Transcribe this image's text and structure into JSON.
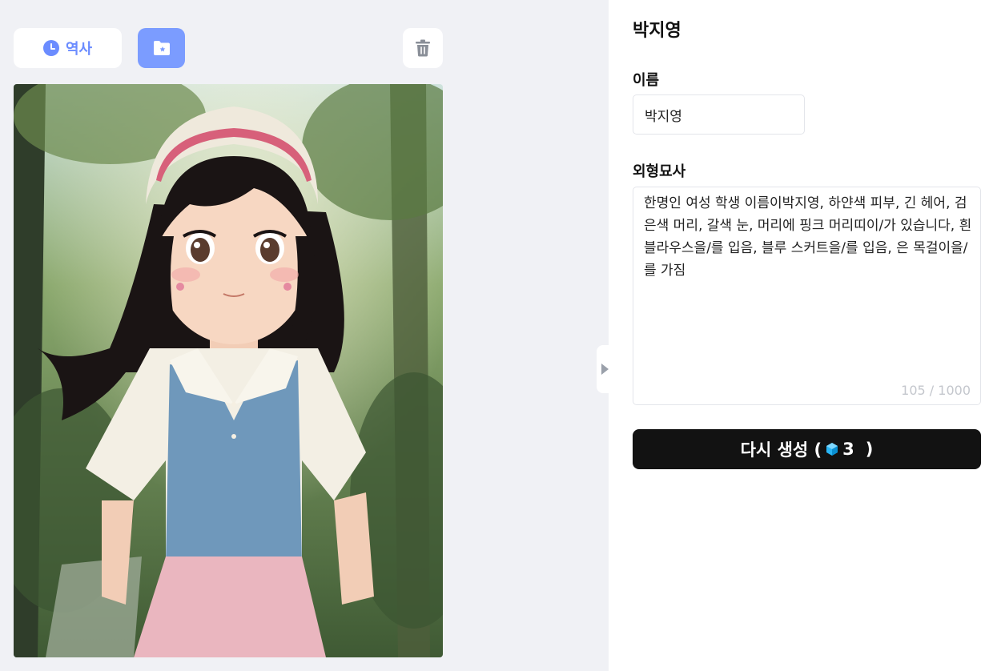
{
  "toolbar": {
    "history_label": "역사",
    "history_icon": "clock-icon",
    "folder_icon": "folder-star-icon",
    "trash_icon": "trash-icon"
  },
  "image": {
    "subject": "character-portrait",
    "colors": {
      "sky": "#cfe3dd",
      "forest": "#5e7a48",
      "hat": "#efe9dc",
      "hat_band": "#d7607a",
      "hair": "#1a1414",
      "skin": "#f7d7c2",
      "blouse": "#f3efe4",
      "vest": "#6f98bb",
      "skirt": "#eab6bf"
    }
  },
  "panel": {
    "title": "박지영",
    "name_label": "이름",
    "name_value": "박지영",
    "description_label": "외형묘사",
    "description_value": "한명인 여성 학생 이름이박지영, 하얀색 피부, 긴 헤어, 검은색 머리, 갈색 눈, 머리에 핑크 머리띠이/가 있습니다, 흰 블라우스을/를 입음, 블루 스커트을/를 입음, 은 목걸이을/를 가짐",
    "char_counter": "105 / 1000",
    "regenerate_label": "다시 생성 (",
    "regenerate_cost": "3",
    "regenerate_close": ")",
    "gem_icon": "gem-icon",
    "gem_color": "#29b6f6"
  },
  "colors": {
    "accent": "#6b8cff",
    "folder_button": "#7b9cff",
    "regenerate_button": "#121212",
    "left_background": "#f0f1f5"
  }
}
